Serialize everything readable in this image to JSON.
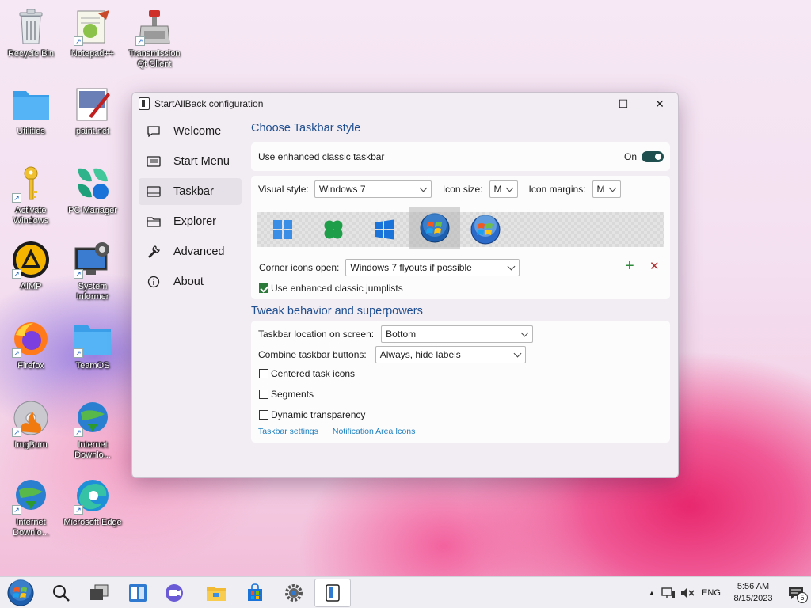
{
  "desktop": {
    "icons": [
      {
        "label": "Recycle Bin"
      },
      {
        "label": "Notepad++"
      },
      {
        "label": "Transmission Qt Client"
      },
      {
        "label": "Utilities"
      },
      {
        "label": "paint.net"
      },
      {
        "label": "Activate Windows"
      },
      {
        "label": "PC Manager"
      },
      {
        "label": "AIMP"
      },
      {
        "label": "System Informer"
      },
      {
        "label": "Firefox"
      },
      {
        "label": "TeamOS"
      },
      {
        "label": "ImgBurn"
      },
      {
        "label": "Internet Downlo..."
      },
      {
        "label": "Internet Downlo..."
      },
      {
        "label": "Microsoft Edge"
      }
    ]
  },
  "window": {
    "title": "StartAllBack configuration",
    "controls": {
      "minimize": "—",
      "maximize": "☐",
      "close": "✕"
    },
    "nav": [
      {
        "label": "Welcome"
      },
      {
        "label": "Start Menu"
      },
      {
        "label": "Taskbar"
      },
      {
        "label": "Explorer"
      },
      {
        "label": "Advanced"
      },
      {
        "label": "About"
      }
    ],
    "section1": {
      "title": "Choose Taskbar style",
      "enhanced_label": "Use enhanced classic taskbar",
      "enhanced_state": "On",
      "visual_style_label": "Visual style:",
      "visual_style_value": "Windows 7",
      "icon_size_label": "Icon size:",
      "icon_size_value": "M",
      "icon_margins_label": "Icon margins:",
      "icon_margins_value": "M",
      "corner_label": "Corner icons open:",
      "corner_value": "Windows 7 flyouts if possible",
      "add_glyph": "+",
      "remove_glyph": "✕",
      "jumplists_label": "Use enhanced classic jumplists",
      "jumplists_checked": true
    },
    "section2": {
      "title": "Tweak behavior and superpowers",
      "location_label": "Taskbar location on screen:",
      "location_value": "Bottom",
      "combine_label": "Combine taskbar buttons:",
      "combine_value": "Always, hide labels",
      "centered_label": "Centered task icons",
      "segments_label": "Segments",
      "transparency_label": "Dynamic transparency",
      "link1": "Taskbar settings",
      "link2": "Notification Area Icons"
    }
  },
  "taskbar": {
    "tray": {
      "language": "ENG",
      "time": "5:56 AM",
      "date": "8/15/2023",
      "notification_count": "5"
    }
  },
  "colors": {
    "accent_blue": "#1f4f8f",
    "link_blue": "#1f7fbf",
    "check_green": "#2c7a3a",
    "remove_red": "#b03030"
  }
}
